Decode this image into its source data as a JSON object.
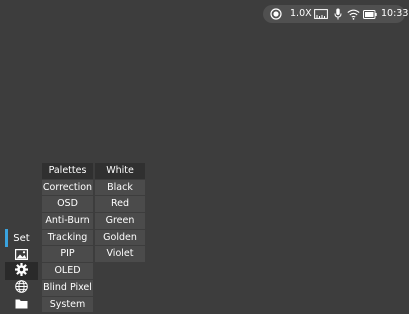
{
  "status_bar": {
    "zoom": "1.0X",
    "time": "10:33",
    "icons": [
      "record-icon",
      "ruler-icon",
      "microphone-icon",
      "wifi-icon",
      "battery-icon"
    ]
  },
  "sidebar": {
    "set_label": "Set",
    "icons": [
      "image-icon",
      "gear-icon",
      "globe-icon",
      "folder-icon"
    ],
    "accent_color": "#3aa3de"
  },
  "menu": {
    "items": [
      {
        "label": "Palettes",
        "selected": true
      },
      {
        "label": "Correction"
      },
      {
        "label": "OSD"
      },
      {
        "label": "Anti-Burn"
      },
      {
        "label": "Tracking"
      },
      {
        "label": "PIP"
      },
      {
        "label": "OLED"
      },
      {
        "label": "Blind Pixel"
      },
      {
        "label": "System"
      }
    ]
  },
  "submenu": {
    "items": [
      {
        "label": "White",
        "selected": true
      },
      {
        "label": "Black"
      },
      {
        "label": "Red"
      },
      {
        "label": "Green"
      },
      {
        "label": "Golden"
      },
      {
        "label": "Violet"
      }
    ]
  }
}
